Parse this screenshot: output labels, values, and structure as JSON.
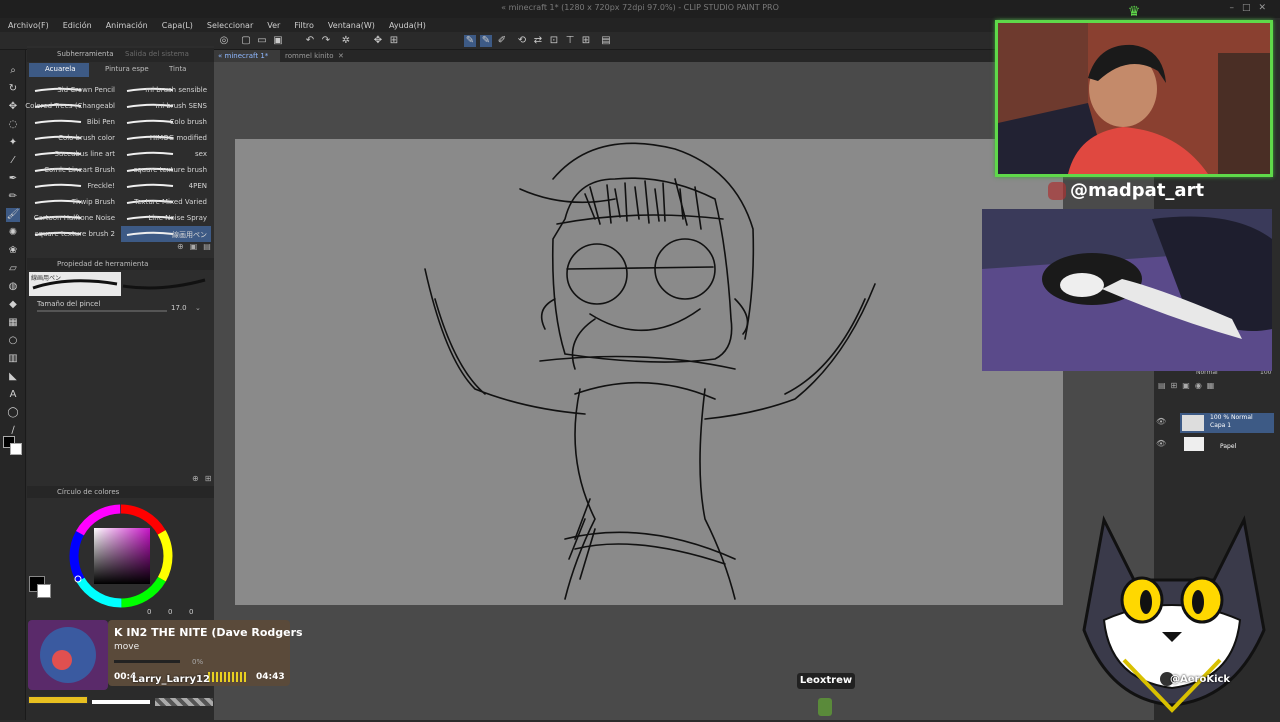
{
  "window": {
    "title": "« minecraft 1* (1280 x 720px 72dpi 97.0%) - CLIP STUDIO PAINT PRO"
  },
  "menu": [
    "Archivo(F)",
    "Edición",
    "Animación",
    "Capa(L)",
    "Seleccionar",
    "Ver",
    "Filtro",
    "Ventana(W)",
    "Ayuda(H)"
  ],
  "doc_tabs": [
    "« minecraft 1*",
    "rommel kinito"
  ],
  "subtool": {
    "header": "Subherramienta",
    "header2": "Salida del sistema",
    "tabs": [
      "Acuarela",
      "Pintura espe",
      "Tinta"
    ],
    "brushes": [
      {
        "name": "Sid Crown Pencil",
        "col": 0
      },
      {
        "name": "mi brush sensible",
        "col": 1
      },
      {
        "name": "Colored Trees (Changeabl",
        "col": 0
      },
      {
        "name": "mi brush SENS",
        "col": 1
      },
      {
        "name": "Bibi Pen",
        "col": 0
      },
      {
        "name": "Colo brush",
        "col": 1
      },
      {
        "name": "Colo brush color",
        "col": 0
      },
      {
        "name": "HIMOG modified",
        "col": 1
      },
      {
        "name": "Succubus line art",
        "col": 0
      },
      {
        "name": "sex",
        "col": 1
      },
      {
        "name": "Comic Lineart Brush",
        "col": 0
      },
      {
        "name": "square texture brush",
        "col": 1
      },
      {
        "name": "Freckle!",
        "col": 0
      },
      {
        "name": "4PEN",
        "col": 1
      },
      {
        "name": "Thwip Brush",
        "col": 0
      },
      {
        "name": "Texture Mixed Varied",
        "col": 1
      },
      {
        "name": "Cartoon Halftone Noise",
        "col": 0
      },
      {
        "name": "Line Noise Spray",
        "col": 1
      },
      {
        "name": "square texture brush 2",
        "col": 0
      },
      {
        "name": "線画用ペン",
        "col": 1
      }
    ],
    "selected_brush": "線画用ペン"
  },
  "tool_property": {
    "header": "Propiedad de herramienta",
    "brush_preview_label": "線画用ペン",
    "size_label": "Tamaño del pincel",
    "size_value": "17.0"
  },
  "color_panel": {
    "header": "Círculo de colores",
    "values": [
      "0",
      "0",
      "0"
    ]
  },
  "layers": {
    "mode_label": "Normal",
    "opacity": "100",
    "items": [
      {
        "name": "Capa 1",
        "info": "100 % Normal"
      },
      {
        "name": "Papel",
        "info": ""
      }
    ]
  },
  "overlay": {
    "handle": "@madpat_art",
    "song_title": "K IN2 THE NITE (Dave Rodgers",
    "song_subtitle": "move",
    "time_elapsed": "00:4",
    "time_total": "04:43",
    "requester": "Larry_Larry12",
    "viewer_tag": "Leoxtrew",
    "mascot_tag": "@AeroKick",
    "percent": "0%"
  },
  "colors": {
    "webcam_border": "#5fd94a",
    "accent": "#3d5a85",
    "canvas_bg": "#8a8a8a"
  }
}
